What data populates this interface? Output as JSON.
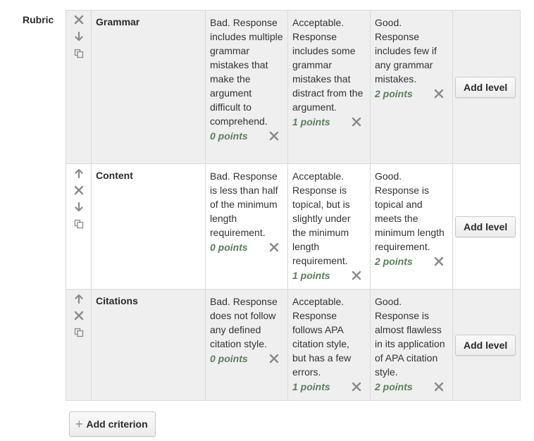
{
  "rubric_label": "Rubric",
  "add_level_label": "Add level",
  "add_criterion_label": "Add criterion",
  "criteria": [
    {
      "name": "Grammar",
      "controls": [
        "delete",
        "move-down",
        "duplicate"
      ],
      "levels": [
        {
          "definition": "Bad. Response includes multiple grammar mistakes that make the argument difficult to comprehend.",
          "points": "0 points"
        },
        {
          "definition": "Acceptable. Response includes some grammar mistakes that distract from the argument.",
          "points": "1 points"
        },
        {
          "definition": "Good. Response includes few if any grammar mistakes.",
          "points": "2 points"
        }
      ]
    },
    {
      "name": "Content",
      "controls": [
        "move-up",
        "delete",
        "move-down",
        "duplicate"
      ],
      "levels": [
        {
          "definition": "Bad. Response is less than half of the minimum length requirement.",
          "points": "0 points"
        },
        {
          "definition": "Acceptable. Response is topical, but is slightly under the minimum length requirement.",
          "points": "1 points"
        },
        {
          "definition": "Good. Response is topical and meets the minimum length requirement.",
          "points": "2 points"
        }
      ]
    },
    {
      "name": "Citations",
      "controls": [
        "move-up",
        "delete",
        "duplicate"
      ],
      "levels": [
        {
          "definition": "Bad. Response does not follow any defined citation style.",
          "points": "0 points"
        },
        {
          "definition": "Acceptable. Response follows APA citation style, but has a few errors.",
          "points": "1 points"
        },
        {
          "definition": "Good. Response is almost flawless in its application of APA citation style.",
          "points": "2 points"
        }
      ]
    }
  ],
  "colors": {
    "points": "#5a7f5a",
    "icon": "#8a8a8a",
    "row_shaded": "#efefef",
    "border": "#dadada"
  }
}
